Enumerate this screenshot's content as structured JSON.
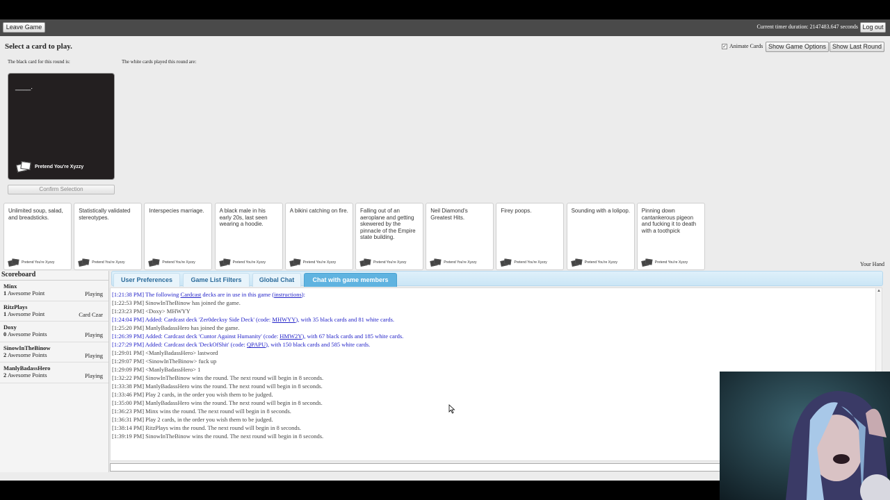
{
  "topbar": {
    "leave_label": "Leave Game",
    "timer_text": "Current timer duration: 2147483.647 seconds",
    "logout_label": "Log out"
  },
  "game": {
    "heading": "Select a card to play.",
    "animate_label": "Animate Cards",
    "animate_checked": true,
    "show_options_label": "Show Game Options",
    "show_last_round_label": "Show Last Round",
    "black_card_label": "The black card for this round is:",
    "white_cards_label": "The white cards played this round are:",
    "black_card_text": "____.",
    "brand": "Pretend You're Xyzzy",
    "confirm_label": "Confirm Selection",
    "your_hand_label": "Your Hand"
  },
  "hand": [
    {
      "text": "Unlimited soup, salad, and breadsticks.",
      "brand": "Pretend You're Xyzzy"
    },
    {
      "text": "Statistically validated stereotypes.",
      "brand": "Pretend You're Xyzzy"
    },
    {
      "text": "Interspecies marriage.",
      "brand": "Pretend You're Xyzzy"
    },
    {
      "text": "A black male in his early 20s, last seen wearing a hoodie.",
      "brand": "Pretend You're Xyzzy"
    },
    {
      "text": "A bikini catching on fire.",
      "brand": "Pretend You're Xyzzy"
    },
    {
      "text": "Falling out of an aeroplane and getting skewered by the pinnacle of the Empire state building.",
      "brand": "Pretend You're Xyzzy"
    },
    {
      "text": "Neil Diamond's Greatest Hits.",
      "brand": "Pretend You're Xyzzy"
    },
    {
      "text": "Firey poops.",
      "brand": "Pretend You're Xyzzy"
    },
    {
      "text": "Sounding with a lolipop.",
      "brand": "Pretend You're Xyzzy"
    },
    {
      "text": "Pinning down cantankerous pigeon and fucking it to death with a toothpick",
      "brand": "Pretend You're Xyzzy"
    }
  ],
  "scoreboard": {
    "title": "Scoreboard",
    "players": [
      {
        "name": "Minx",
        "score": "1",
        "points_label": "Awesome Point",
        "status": "Playing"
      },
      {
        "name": "RitzPlays",
        "score": "1",
        "points_label": "Awesome Point",
        "status": "Card Czar"
      },
      {
        "name": "Doxy",
        "score": "0",
        "points_label": "Awesome Points",
        "status": "Playing"
      },
      {
        "name": "SinowInTheBinow",
        "score": "2",
        "points_label": "Awesome Points",
        "status": "Playing"
      },
      {
        "name": "ManlyBadassHero",
        "score": "2",
        "points_label": "Awesome Points",
        "status": "Playing"
      }
    ]
  },
  "tabs": [
    {
      "label": "User Preferences"
    },
    {
      "label": "Game List Filters"
    },
    {
      "label": "Global Chat"
    },
    {
      "label": "Chat with game members"
    }
  ],
  "chat": [
    {
      "ts": "[1:21:38 PM]",
      "a": " The following ",
      "b": "Cardcast",
      "c": " decks are in use in this game (",
      "d": "instructions",
      "e": "):"
    },
    {
      "ts": "[1:22:53 PM]",
      "text": " SinowInTheBinow has joined the game."
    },
    {
      "ts": "[1:23:23 PM]",
      "text": " <Doxy> MHWYY"
    },
    {
      "ts": "[1:24:04 PM]",
      "a": " Added: Cardcast deck 'Zer0decksy Side Deck' (code: ",
      "code": "MHWYY",
      "e": "), with 35 black cards and 81 white cards."
    },
    {
      "ts": "[1:25:20 PM]",
      "text": " ManlyBadassHero has joined the game."
    },
    {
      "ts": "[1:26:39 PM]",
      "a": " Added: Cardcast deck 'Cuntor Against Humanity' (code: ",
      "code": "HMW2Y",
      "e": "), with 67 black cards and 185 white cards."
    },
    {
      "ts": "[1:27:29 PM]",
      "a": " Added: Cardcast deck 'DeckOfShit' (code: ",
      "code": "QPAPU",
      "e": "), with 150 black cards and 585 white cards."
    },
    {
      "ts": "[1:29:01 PM]",
      "text": " <ManlyBadassHero> lastword"
    },
    {
      "ts": "[1:29:07 PM]",
      "text": " <SinowInTheBinow> fuck up"
    },
    {
      "ts": "[1:29:09 PM]",
      "text": " <ManlyBadassHero> 1"
    },
    {
      "ts": "[1:32:22 PM]",
      "text": " SinowInTheBinow wins the round. The next round will begin in 8 seconds."
    },
    {
      "ts": "[1:33:38 PM]",
      "text": " ManlyBadassHero wins the round. The next round will begin in 8 seconds."
    },
    {
      "ts": "[1:33:46 PM]",
      "text": " Play 2 cards, in the order you wish them to be judged."
    },
    {
      "ts": "[1:35:00 PM]",
      "text": " ManlyBadassHero wins the round. The next round will begin in 8 seconds."
    },
    {
      "ts": "[1:36:23 PM]",
      "text": " Minx wins the round. The next round will begin in 8 seconds."
    },
    {
      "ts": "[1:36:31 PM]",
      "text": " Play 2 cards, in the order you wish them to be judged."
    },
    {
      "ts": "[1:38:14 PM]",
      "text": " RitzPlays wins the round. The next round will begin in 8 seconds."
    },
    {
      "ts": "[1:39:19 PM]",
      "text": " SinowInTheBinow wins the round. The next round will begin in 8 seconds."
    }
  ],
  "chat_input": {
    "value": ""
  },
  "colors": {
    "system_message": "#2323c8",
    "active_tab": "#5fb3e0",
    "black_card": "#231f20"
  }
}
